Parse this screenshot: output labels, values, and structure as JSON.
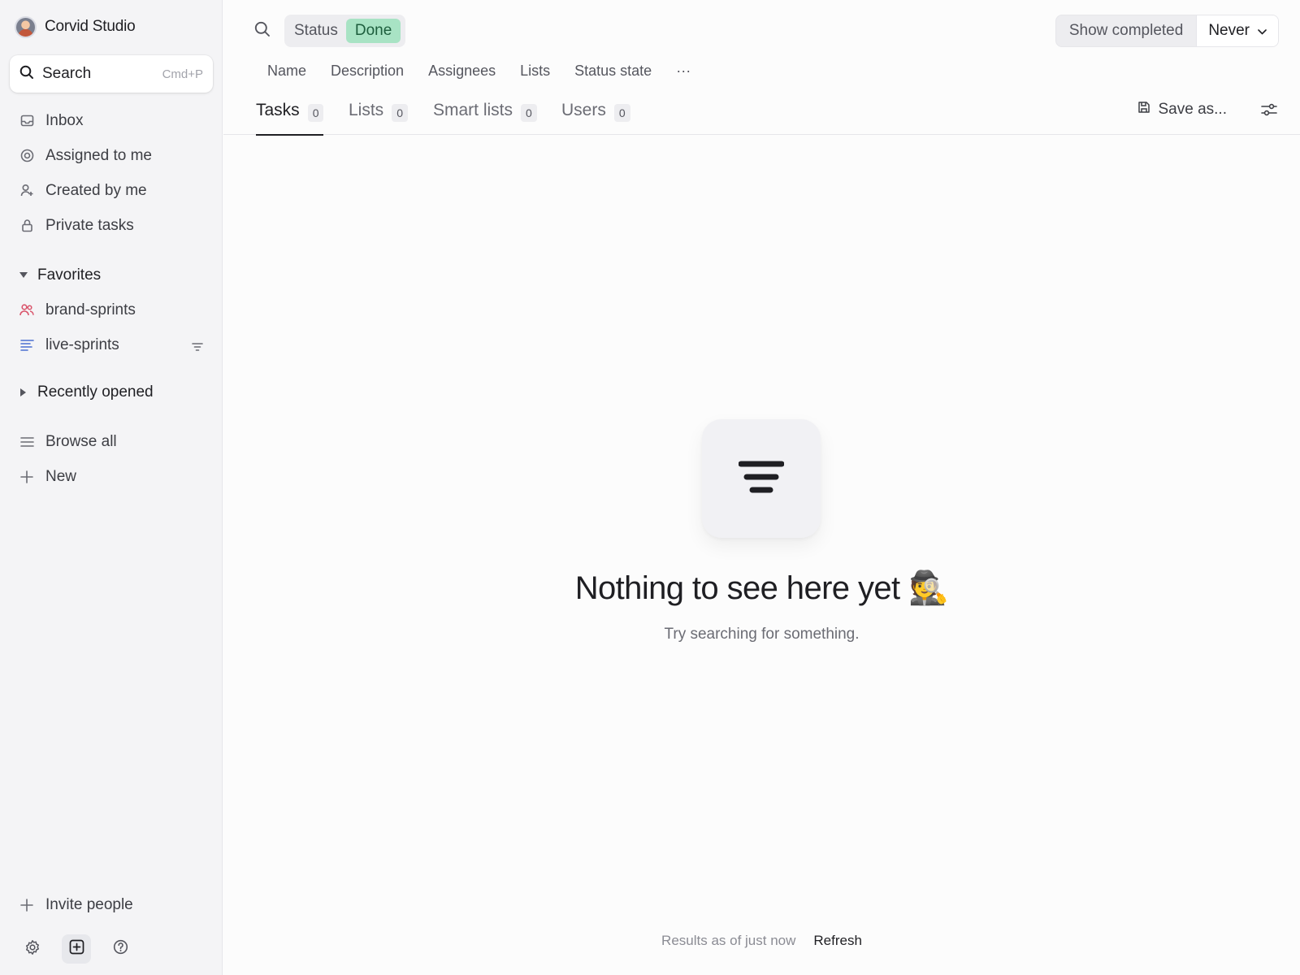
{
  "sidebar": {
    "workspace_name": "Corvid Studio",
    "search": {
      "label": "Search",
      "shortcut": "Cmd+P"
    },
    "nav": [
      {
        "label": "Inbox",
        "icon": "inbox-icon"
      },
      {
        "label": "Assigned to me",
        "icon": "target-icon"
      },
      {
        "label": "Created by me",
        "icon": "user-plus-icon"
      },
      {
        "label": "Private tasks",
        "icon": "lock-icon"
      }
    ],
    "favorites": {
      "title": "Favorites",
      "items": [
        {
          "label": "brand-sprints",
          "icon": "team-icon",
          "color": "#d9546b"
        },
        {
          "label": "live-sprints",
          "icon": "list-icon",
          "color": "#4a6fd1"
        }
      ]
    },
    "recently_opened": {
      "title": "Recently opened"
    },
    "browse_all": "Browse all",
    "new": "New",
    "invite": "Invite people"
  },
  "filter": {
    "field": "Status",
    "value": "Done"
  },
  "show_completed": {
    "label": "Show completed",
    "value": "Never"
  },
  "fields": [
    "Name",
    "Description",
    "Assignees",
    "Lists",
    "Status state",
    "···"
  ],
  "tabs": [
    {
      "label": "Tasks",
      "count": "0"
    },
    {
      "label": "Lists",
      "count": "0"
    },
    {
      "label": "Smart lists",
      "count": "0"
    },
    {
      "label": "Users",
      "count": "0"
    }
  ],
  "save_as": "Save as...",
  "empty": {
    "title": "Nothing to see here yet 🕵️",
    "subtitle": "Try searching for something."
  },
  "footer": {
    "status": "Results as of just now",
    "refresh": "Refresh"
  },
  "colors": {
    "done_badge_bg": "#a8e3c4",
    "done_badge_text": "#1d5e3d",
    "sidebar_bg": "#f4f4f6"
  }
}
